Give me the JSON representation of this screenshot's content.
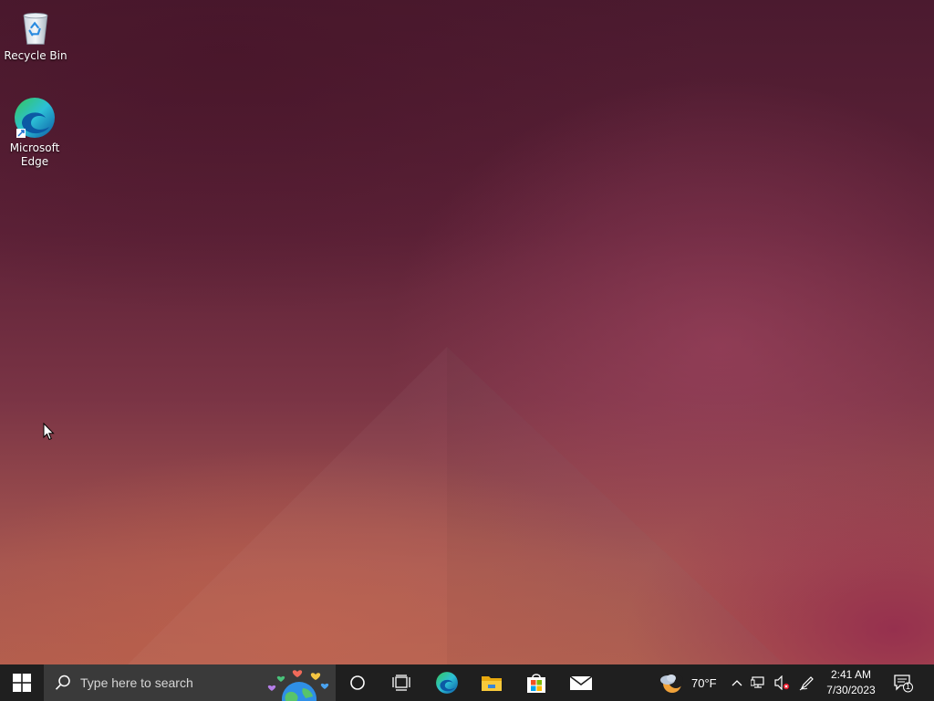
{
  "desktop": {
    "icons": [
      {
        "label": "Recycle Bin",
        "icon": "recycle-bin-icon"
      },
      {
        "label": "Microsoft Edge",
        "icon": "edge-icon"
      }
    ]
  },
  "taskbar": {
    "search": {
      "placeholder": "Type here to search"
    },
    "pinned": [
      {
        "name": "Cortana",
        "icon": "cortana-circle-icon"
      },
      {
        "name": "Task View",
        "icon": "task-view-icon"
      },
      {
        "name": "Microsoft Edge",
        "icon": "edge-icon"
      },
      {
        "name": "File Explorer",
        "icon": "folder-icon"
      },
      {
        "name": "Microsoft Store",
        "icon": "store-bag-icon"
      },
      {
        "name": "Mail",
        "icon": "mail-icon"
      }
    ],
    "weather": {
      "temperature": "70°F",
      "icon": "moon-cloud-icon"
    },
    "clock": {
      "time": "2:41 AM",
      "date": "7/30/2023"
    },
    "notifications": {
      "count": "1"
    }
  },
  "colors": {
    "taskbar_bg": "#1f1f1f",
    "search_bg": "#3a3a3a",
    "edge_blue": "#0c59a4",
    "edge_green": "#35c759"
  }
}
